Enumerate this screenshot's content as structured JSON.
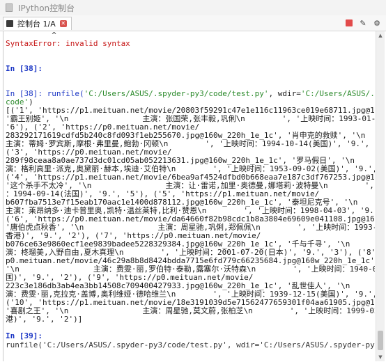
{
  "window": {
    "title": "IPython控制台"
  },
  "tab": {
    "label": "控制台 1/A"
  },
  "console": {
    "caret": "          ^",
    "error": "SyntaxError: invalid syntax",
    "prompt38": "In [38]:",
    "cmd_prefix": "In [38]: runfile(",
    "cmd_path1": "'C:/Users/ASUS/.spyder-py3/code/test.py'",
    "cmd_mid": ", wdir=",
    "cmd_path2a": "'C:/Users/ASUS/.spyder-py3/",
    "cmd_path2b": "code'",
    "cmd_close": ")",
    "output": [
      "[('1', 'https://p1.meituan.net/movie/20803f59291c47e1e116c11963ce019e68711.jpg@160w_220h_1e_1c',",
      "'霸王别姬', '\\n                主演：张国荣,张丰毅,巩俐\\n        ', '上映时间：1993-01-01', '9.',",
      "'6'), ('2', 'https://p0.meituan.net/movie/",
      "283292171619cdfd5b240c8fd093f1eb255670.jpg@160w_220h_1e_1c', '肖申克的救赎', '\\n",
      "主演：蒂姆·罗宾斯,摩根·弗里曼,鲍勃·冈顿\\n        ', '上映时间：1994-10-14(美国)', '9.', '5'),",
      "('3', 'https://p0.meituan.net/movie/",
      "289f98ceaa8a0ae737d3dc01cd05ab052213631.jpg@160w_220h_1e_1c', '罗马假日', '\\n        主",
      "演：格利高里·派克,奥黛丽·赫本,埃迪·艾伯特\\n        ', '上映时间：1953-09-02(美国)', '9.', '1'),",
      "('4', 'https://p1.meituan.net/movie/6bea9af4524dfbd0b668eaa7e187c3df767253.jpg@160w_220h_1e_1c',",
      "'这个杀手不太冷', '\\n                主演：让·雷诺,加里·奥德曼,娜塔莉·波特曼\\n        ', '上映时间",
      "：1994-09-14(法国)', '9.', '5'), ('5', 'https://p1.meituan.net/movie/",
      "b607fba7513e7f15eab170aac1e1400d878112.jpg@160w_220h_1e_1c', '泰坦尼克号', '\\n",
      "主演：莱昂纳多·迪卡普里奥,凯特·温丝莱特,比利·赞恩\\n        ', '上映时间：1998-04-03', '9.', '5'),",
      "('6', 'https://p0.meituan.net/movie/da64660f82b98cdc1b8a3804e69609e041108.jpg@160w_220h_1e_1c',",
      "'唐伯虎点秋香', '\\n                主演：周星驰,巩俐,郑佩佩\\n        ', '上映时间：1993-07-01(中国",
      "香港)', '9.', '2'), ('7', 'https://p0.meituan.net/movie/",
      "b076ce63e9860ecf1ee9839badee5228329384.jpg@160w_220h_1e_1c', '千与千寻', '\\n        主",
      "演：柊瑠美,入野自由,夏木真理\\n        ', '上映时间：2001-07-20(日本)', '9.', '3'), ('8', 'https://",
      "p0.meituan.net/movie/46c29a8b8d8424bdda7715e6fd779c66235684.jpg@160w_220h_1e_1c', '魂断蓝桥',",
      "'\\n                主演：费雯·丽,罗伯特·泰勒,露塞尔·沃特森\\n        ', '上映时间：1940-05-17(美",
      "国)', '9.', '2'), ('9', 'https://p0.meituan.net/movie/",
      "223c3e186db3ab4ea3bb14508c709400427933.jpg@160w_220h_1e_1c', '乱世佳人', '\\n        主",
      "演：费雯·丽,克拉克·盖博,奥利维娅·德哈维兰\\n        ', '上映时间：1939-12-15(美国)', '9.', '1'),",
      "('10', 'https://p1.meituan.net/movie/18e3191039d5e71562477659301f04aa61905.jpg@160w_220h_1e_1c',",
      "'喜剧之王', '\\n                主演：周星驰,莫文蔚,张柏芝\\n        ', '上映时间：1999-02-13(中国香",
      "港)', '9.', '2')]"
    ],
    "prompt39": "In [39]:",
    "cut_cmd": "runfile('C:/Users/ASUS/.spyder-py3/code/test.py', wdir='C:/Users/ASUS/.spyder-py3/code/test.py')"
  }
}
